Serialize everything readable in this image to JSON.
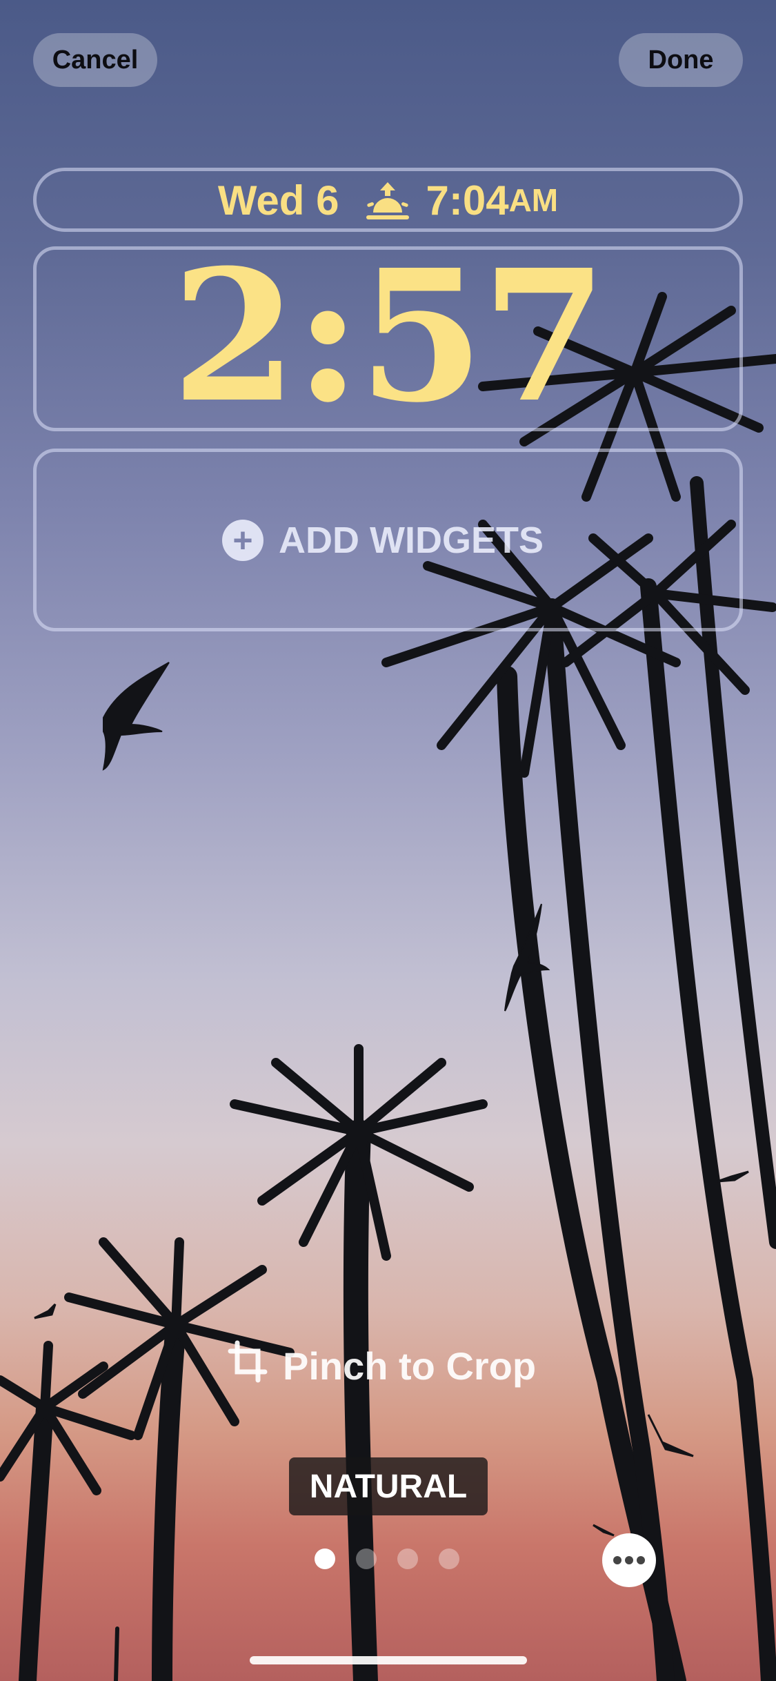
{
  "nav": {
    "cancel_label": "Cancel",
    "done_label": "Done"
  },
  "lock_screen": {
    "date": "Wed 6",
    "sunrise_time": "7:04",
    "sunrise_ampm": "AM",
    "time": "2:57",
    "add_widgets_label": "ADD WIDGETS"
  },
  "editor": {
    "crop_hint": "Pinch to Crop",
    "filter_label": "NATURAL",
    "page_count": 4,
    "active_page": 1
  },
  "icons": {
    "add": "plus-circle-icon",
    "crop": "crop-icon",
    "sunrise": "sunrise-icon",
    "more": "ellipsis-icon"
  },
  "colors": {
    "clock": "#fbe286",
    "date": "#f9df83",
    "sky_top": "#4b5a88",
    "sky_bottom": "#b4605e"
  }
}
